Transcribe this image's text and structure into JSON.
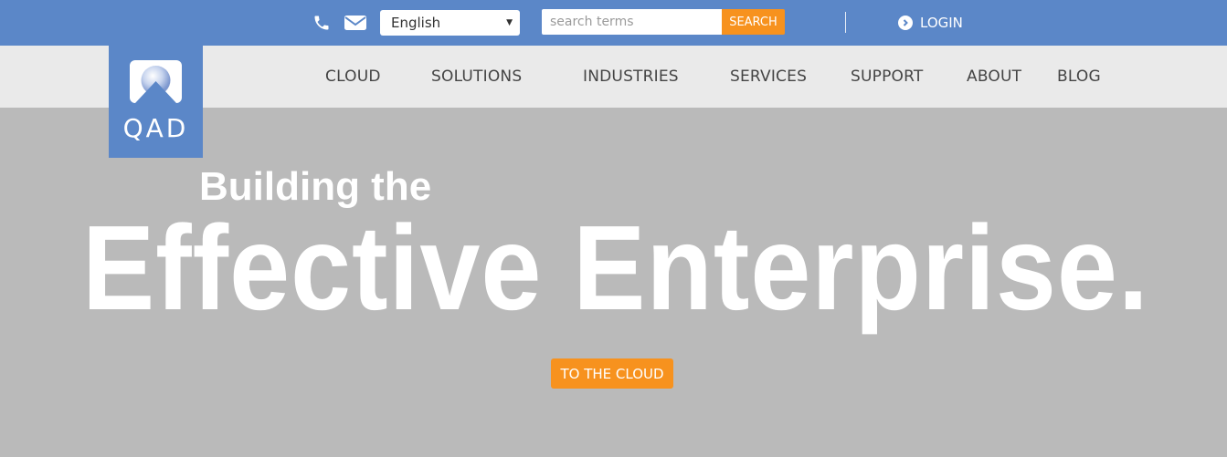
{
  "topbar": {
    "phone_icon": "phone-icon",
    "mail_icon": "envelope-icon",
    "language": {
      "selected": "English",
      "icon": "caret-down-icon"
    },
    "search": {
      "placeholder": "search terms",
      "value": "",
      "button_label": "SEARCH"
    },
    "login": {
      "label": "LOGIN",
      "icon": "circle-chevron-right-icon"
    }
  },
  "logo": {
    "text": "QAD"
  },
  "nav": {
    "items": [
      {
        "label": "CLOUD"
      },
      {
        "label": "SOLUTIONS"
      },
      {
        "label": "INDUSTRIES"
      },
      {
        "label": "SERVICES"
      },
      {
        "label": "SUPPORT"
      },
      {
        "label": "ABOUT"
      },
      {
        "label": "BLOG"
      }
    ]
  },
  "hero": {
    "line1": "Building the",
    "line2": "Effective Enterprise.",
    "cta_label": "TO THE CLOUD"
  },
  "colors": {
    "brand_blue": "#5b87c8",
    "accent_orange": "#f7921e",
    "nav_bg": "#eaeaea",
    "hero_bg": "#bababa"
  }
}
